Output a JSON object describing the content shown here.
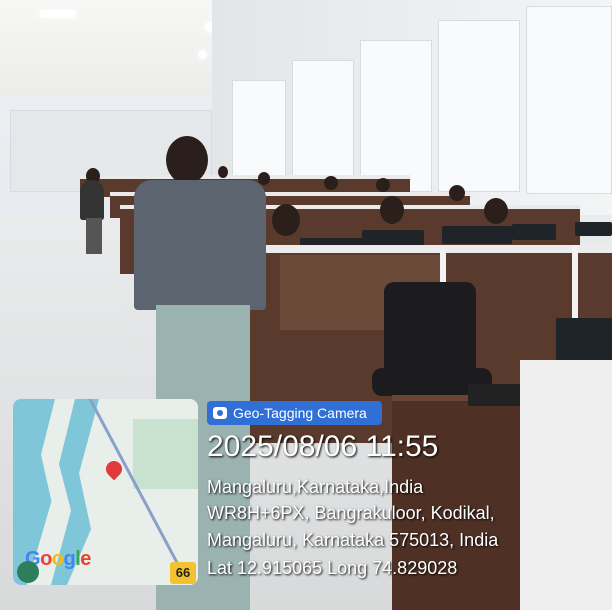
{
  "geo_tag": {
    "label": "Geo-Tagging Camera",
    "icon": "camera-icon"
  },
  "stamp": {
    "datetime": "2025/08/06 11:55",
    "city_line": "Mangaluru,Karnataka,India",
    "address_line1": "WR8H+6PX, Bangrakuloor, Kodikal,",
    "address_line2": "Mangaluru, Karnataka 575013, India",
    "coords_line": "Lat 12.915065 Long 74.829028"
  },
  "map": {
    "logo": "Google",
    "route_badge": "66",
    "pin_icon": "location-pin-icon"
  },
  "colors": {
    "tag_blue": "#2f6fd6",
    "badge_yellow": "#f2c230",
    "pin_red": "#e03a3a"
  }
}
